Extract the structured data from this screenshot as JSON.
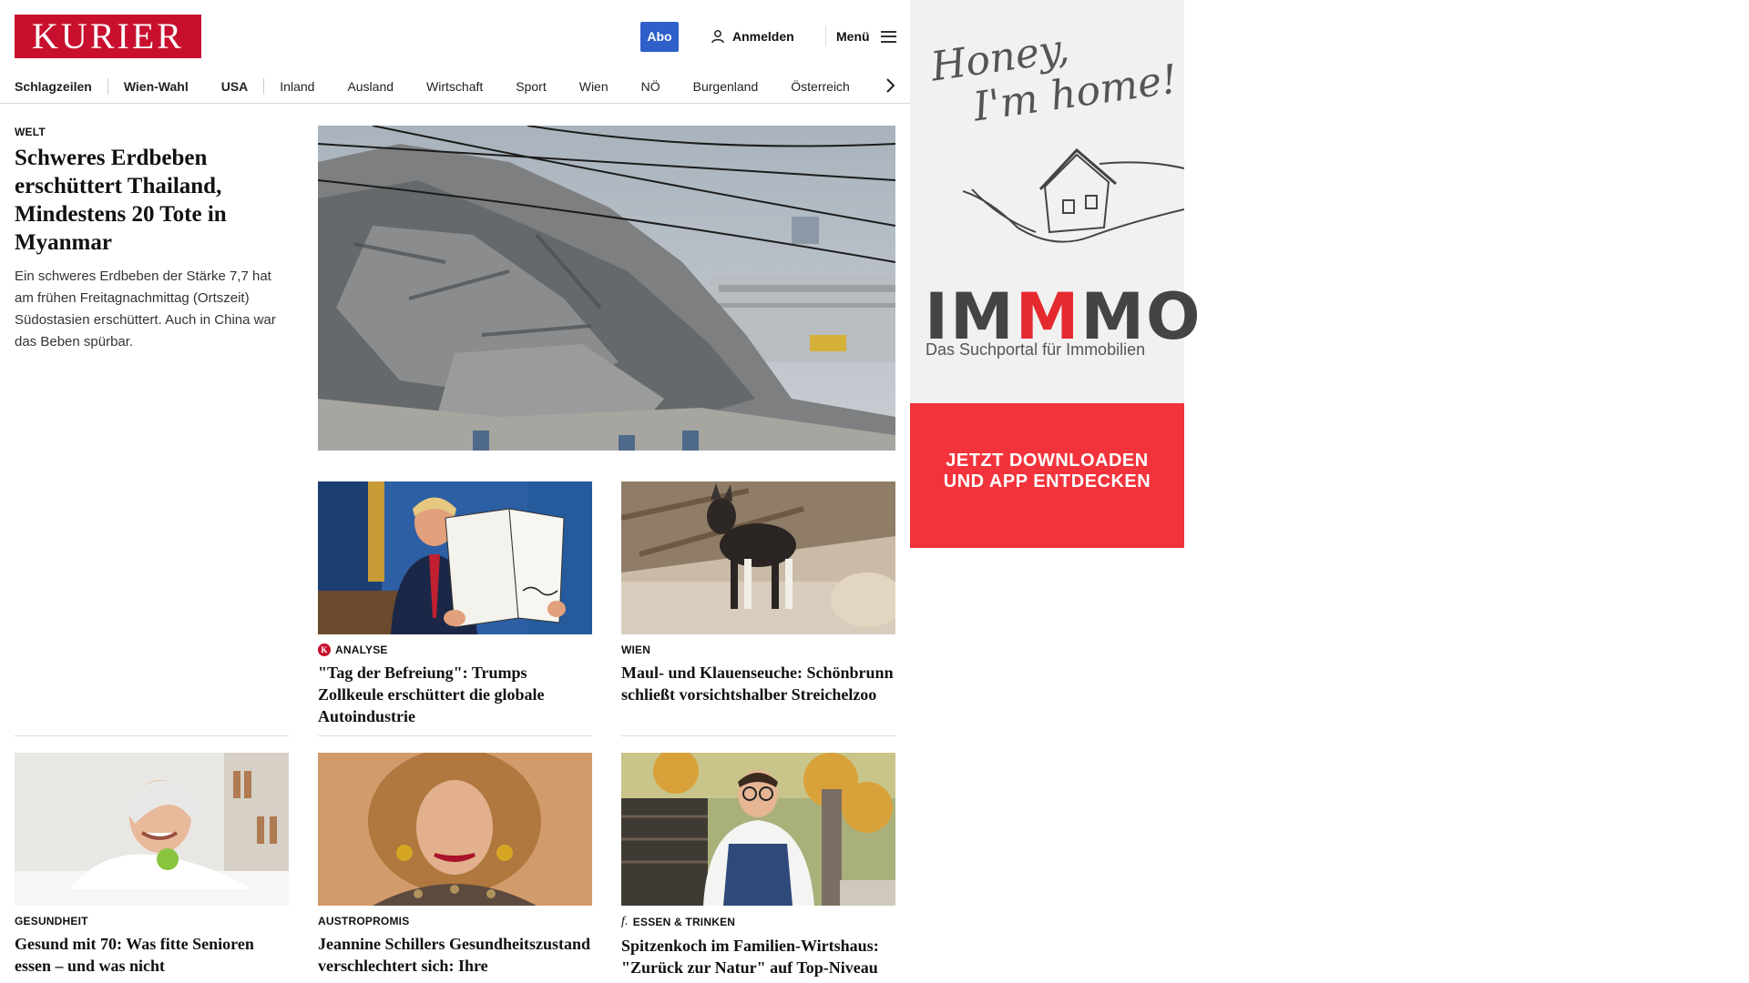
{
  "header": {
    "logo": "KURIER",
    "abo_label": "Abo",
    "login_label": "Anmelden",
    "menu_label": "Menü"
  },
  "nav": {
    "items": [
      {
        "label": "Schlagzeilen"
      },
      {
        "label": "Wien-Wahl"
      },
      {
        "label": "USA"
      },
      {
        "label": "Inland"
      },
      {
        "label": "Ausland"
      },
      {
        "label": "Wirtschaft"
      },
      {
        "label": "Sport"
      },
      {
        "label": "Wien"
      },
      {
        "label": "NÖ"
      },
      {
        "label": "Burgenland"
      },
      {
        "label": "Österreich"
      }
    ]
  },
  "lead": {
    "kicker": "WELT",
    "headline": "Schweres Erdbeben erschüttert Thailand, Mindestens 20 Tote in Myanmar",
    "text": "Ein schweres Erdbeben der Stärke 7,7 hat am frühen Freitagnachmittag (Ortszeit) Südostasien erschüttert. Auch in China war das Beben spürbar."
  },
  "cards": [
    {
      "kicker": "ANALYSE",
      "headline": "\"Tag der Befreiung\": Trumps Zollkeule erschüttert die globale Autoindustrie"
    },
    {
      "kicker": "WIEN",
      "headline": "Maul- und Klauenseuche: Schönbrunn schließt vorsichtshalber Streichelzoo"
    },
    {
      "kicker": "GESUNDHEIT",
      "headline": "Gesund mit 70: Was fitte Senioren essen – und was nicht"
    },
    {
      "kicker": "AUSTROPROMIS",
      "headline": "Jeannine Schillers Gesundheitszustand verschlechtert sich: Ihre"
    },
    {
      "kicker": "ESSEN & TRINKEN",
      "headline": "Spitzenkoch im Familien-Wirtshaus: \"Zurück zur Natur\" auf Top-Niveau"
    }
  ],
  "ad": {
    "script_line1": "Honey,",
    "script_line2": "I'm home!",
    "brand_a": "IM",
    "brand_b": "M",
    "brand_c": "MO",
    "tagline": "Das Suchportal für Immobilien",
    "cta_line1": "JETZT DOWNLOADEN",
    "cta_line2": "UND APP ENTDECKEN",
    "accent": "#f2333b"
  },
  "colors": {
    "brand": "#c8102e",
    "abo": "#2f5fc9"
  }
}
